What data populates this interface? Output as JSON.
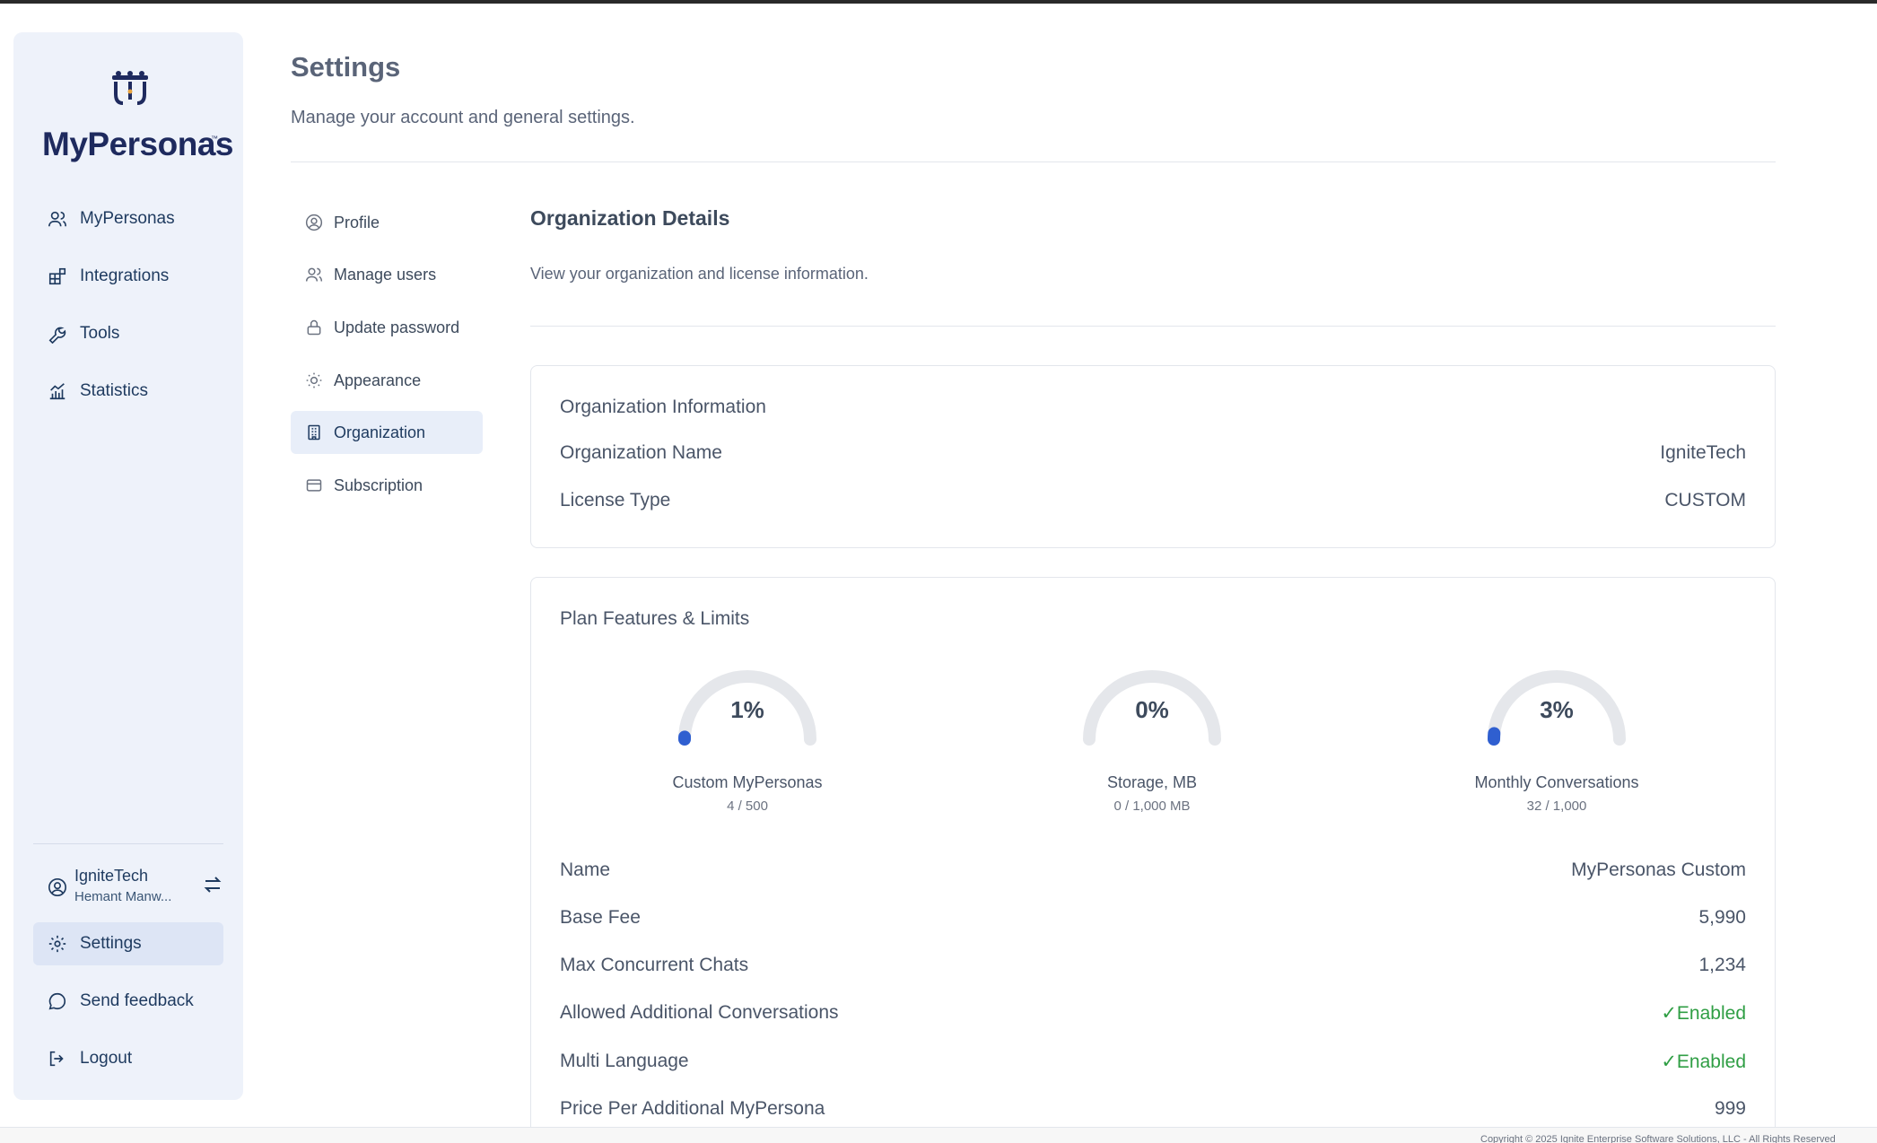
{
  "brand": {
    "name": "MyPersonas",
    "tm": "™"
  },
  "sidebar": {
    "items": [
      {
        "label": "MyPersonas",
        "icon": "users-icon"
      },
      {
        "label": "Integrations",
        "icon": "puzzle-icon"
      },
      {
        "label": "Tools",
        "icon": "wrench-icon"
      },
      {
        "label": "Statistics",
        "icon": "chart-icon"
      }
    ],
    "account": {
      "org": "IgniteTech",
      "user": "Hemant Manw..."
    },
    "bottom": [
      {
        "label": "Settings",
        "icon": "gear-icon"
      },
      {
        "label": "Send feedback",
        "icon": "chat-icon"
      },
      {
        "label": "Logout",
        "icon": "logout-icon"
      }
    ]
  },
  "header": {
    "title": "Settings",
    "subtitle": "Manage your account and general settings."
  },
  "settings_nav": [
    {
      "label": "Profile",
      "icon": "user-circle-icon"
    },
    {
      "label": "Manage users",
      "icon": "users-icon"
    },
    {
      "label": "Update password",
      "icon": "lock-icon"
    },
    {
      "label": "Appearance",
      "icon": "sun-icon"
    },
    {
      "label": "Organization",
      "icon": "building-icon"
    },
    {
      "label": "Subscription",
      "icon": "card-icon"
    }
  ],
  "section": {
    "title": "Organization Details",
    "subtitle": "View your organization and license information."
  },
  "org_card": {
    "title": "Organization Information",
    "rows": [
      {
        "label": "Organization Name",
        "value": "IgniteTech"
      },
      {
        "label": "License Type",
        "value": "CUSTOM"
      }
    ]
  },
  "plan_card": {
    "title": "Plan Features & Limits",
    "gauges": [
      {
        "percent": 1,
        "pct_label": "1%",
        "label": "Custom MyPersonas",
        "usage": "4 / 500"
      },
      {
        "percent": 0,
        "pct_label": "0%",
        "label": "Storage, MB",
        "usage": "0 / 1,000 MB"
      },
      {
        "percent": 3,
        "pct_label": "3%",
        "label": "Monthly Conversations",
        "usage": "32 / 1,000"
      }
    ],
    "rows": [
      {
        "label": "Name",
        "value": "MyPersonas Custom"
      },
      {
        "label": "Base Fee",
        "value": "5,990"
      },
      {
        "label": "Max Concurrent Chats",
        "value": "1,234"
      },
      {
        "label": "Allowed Additional Conversations",
        "value": "✓Enabled"
      },
      {
        "label": "Multi Language",
        "value": "✓Enabled"
      },
      {
        "label": "Price Per Additional MyPersona",
        "value": "999"
      }
    ]
  },
  "footer": "Copyright © 2025 Ignite Enterprise Software Solutions, LLC - All Rights Reserved",
  "colors": {
    "accent": "#2f5fd0",
    "enabled": "#2f9e44",
    "sidebar_bg": "#eef2fa",
    "gauge_track": "#e5e7eb"
  }
}
